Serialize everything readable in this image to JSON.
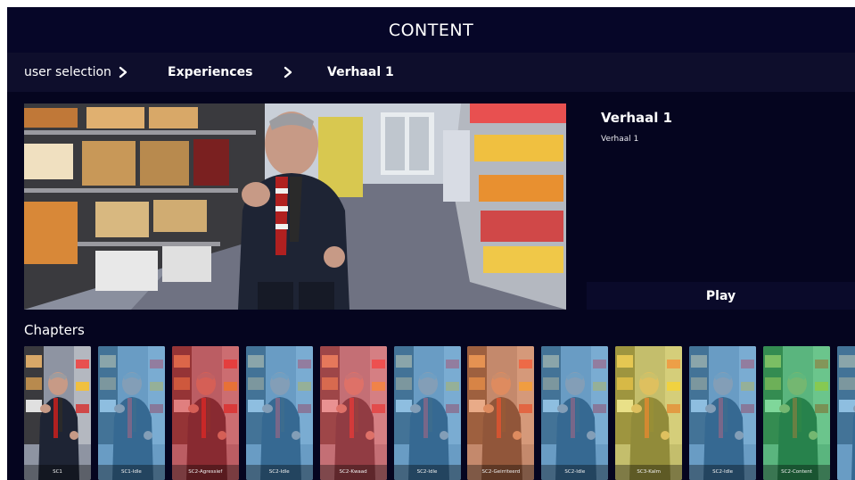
{
  "header": {
    "title": "CONTENT"
  },
  "breadcrumb": {
    "items": [
      {
        "label": "user selection"
      },
      {
        "label": "Experiences"
      },
      {
        "label": "Verhaal 1"
      }
    ]
  },
  "detail": {
    "title": "Verhaal 1",
    "subtitle": "Verhaal 1",
    "play_label": "Play"
  },
  "chapters": {
    "heading": "Chapters",
    "items": [
      {
        "label": "SC1",
        "tint": "none"
      },
      {
        "label": "SC1-Idle",
        "tint": "#4aa3e0"
      },
      {
        "label": "SC2-Agressief",
        "tint": "#e03030"
      },
      {
        "label": "SC2-Idle",
        "tint": "#4aa3e0"
      },
      {
        "label": "SC2-Kwaad",
        "tint": "#f05050"
      },
      {
        "label": "SC2-Idle",
        "tint": "#4aa3e0"
      },
      {
        "label": "SC2-Geirriteerd",
        "tint": "#f08040"
      },
      {
        "label": "SC2-Idle",
        "tint": "#4aa3e0"
      },
      {
        "label": "SC3-Kalm",
        "tint": "#f0e040"
      },
      {
        "label": "SC2-Idle",
        "tint": "#4aa3e0"
      },
      {
        "label": "SC2-Content",
        "tint": "#30d060"
      },
      {
        "label": "",
        "tint": "#4aa3e0"
      }
    ]
  }
}
